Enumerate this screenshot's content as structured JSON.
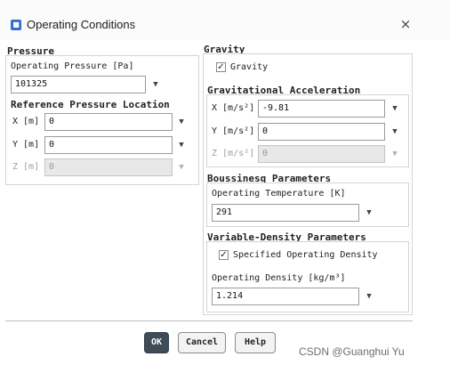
{
  "window": {
    "title": "Operating Conditions",
    "close_symbol": "×",
    "icon": "app-icon"
  },
  "pressure": {
    "section_title": "Pressure",
    "operating_pressure_label": "Operating Pressure [Pa]",
    "operating_pressure_value": "101325",
    "ref_location_title": "Reference Pressure Location",
    "x_label": "X [m]",
    "x_value": "0",
    "y_label": "Y [m]",
    "y_value": "0",
    "z_label": "Z [m]",
    "z_value": "0"
  },
  "gravity": {
    "section_title": "Gravity",
    "checkbox_label": "Gravity",
    "checked": true,
    "accel_title": "Gravitational Acceleration",
    "x_label": "X [m/s²]",
    "x_value": "-9.81",
    "y_label": "Y [m/s²]",
    "y_value": "0",
    "z_label": "Z [m/s²]",
    "z_value": "0"
  },
  "boussinesq": {
    "title": "Boussinesq Parameters",
    "op_temp_label": "Operating Temperature [K]",
    "op_temp_value": "291"
  },
  "variable_density": {
    "title": "Variable-Density Parameters",
    "checkbox_label": "Specified Operating Density",
    "checked": true,
    "op_density_label": "Operating Density [kg/m³]",
    "op_density_value": "1.214"
  },
  "buttons": {
    "ok": "OK",
    "cancel": "Cancel",
    "help": "Help"
  },
  "watermark": "CSDN @Guanghui Yu",
  "glyphs": {
    "dropdown": "▼",
    "check": "✓"
  }
}
